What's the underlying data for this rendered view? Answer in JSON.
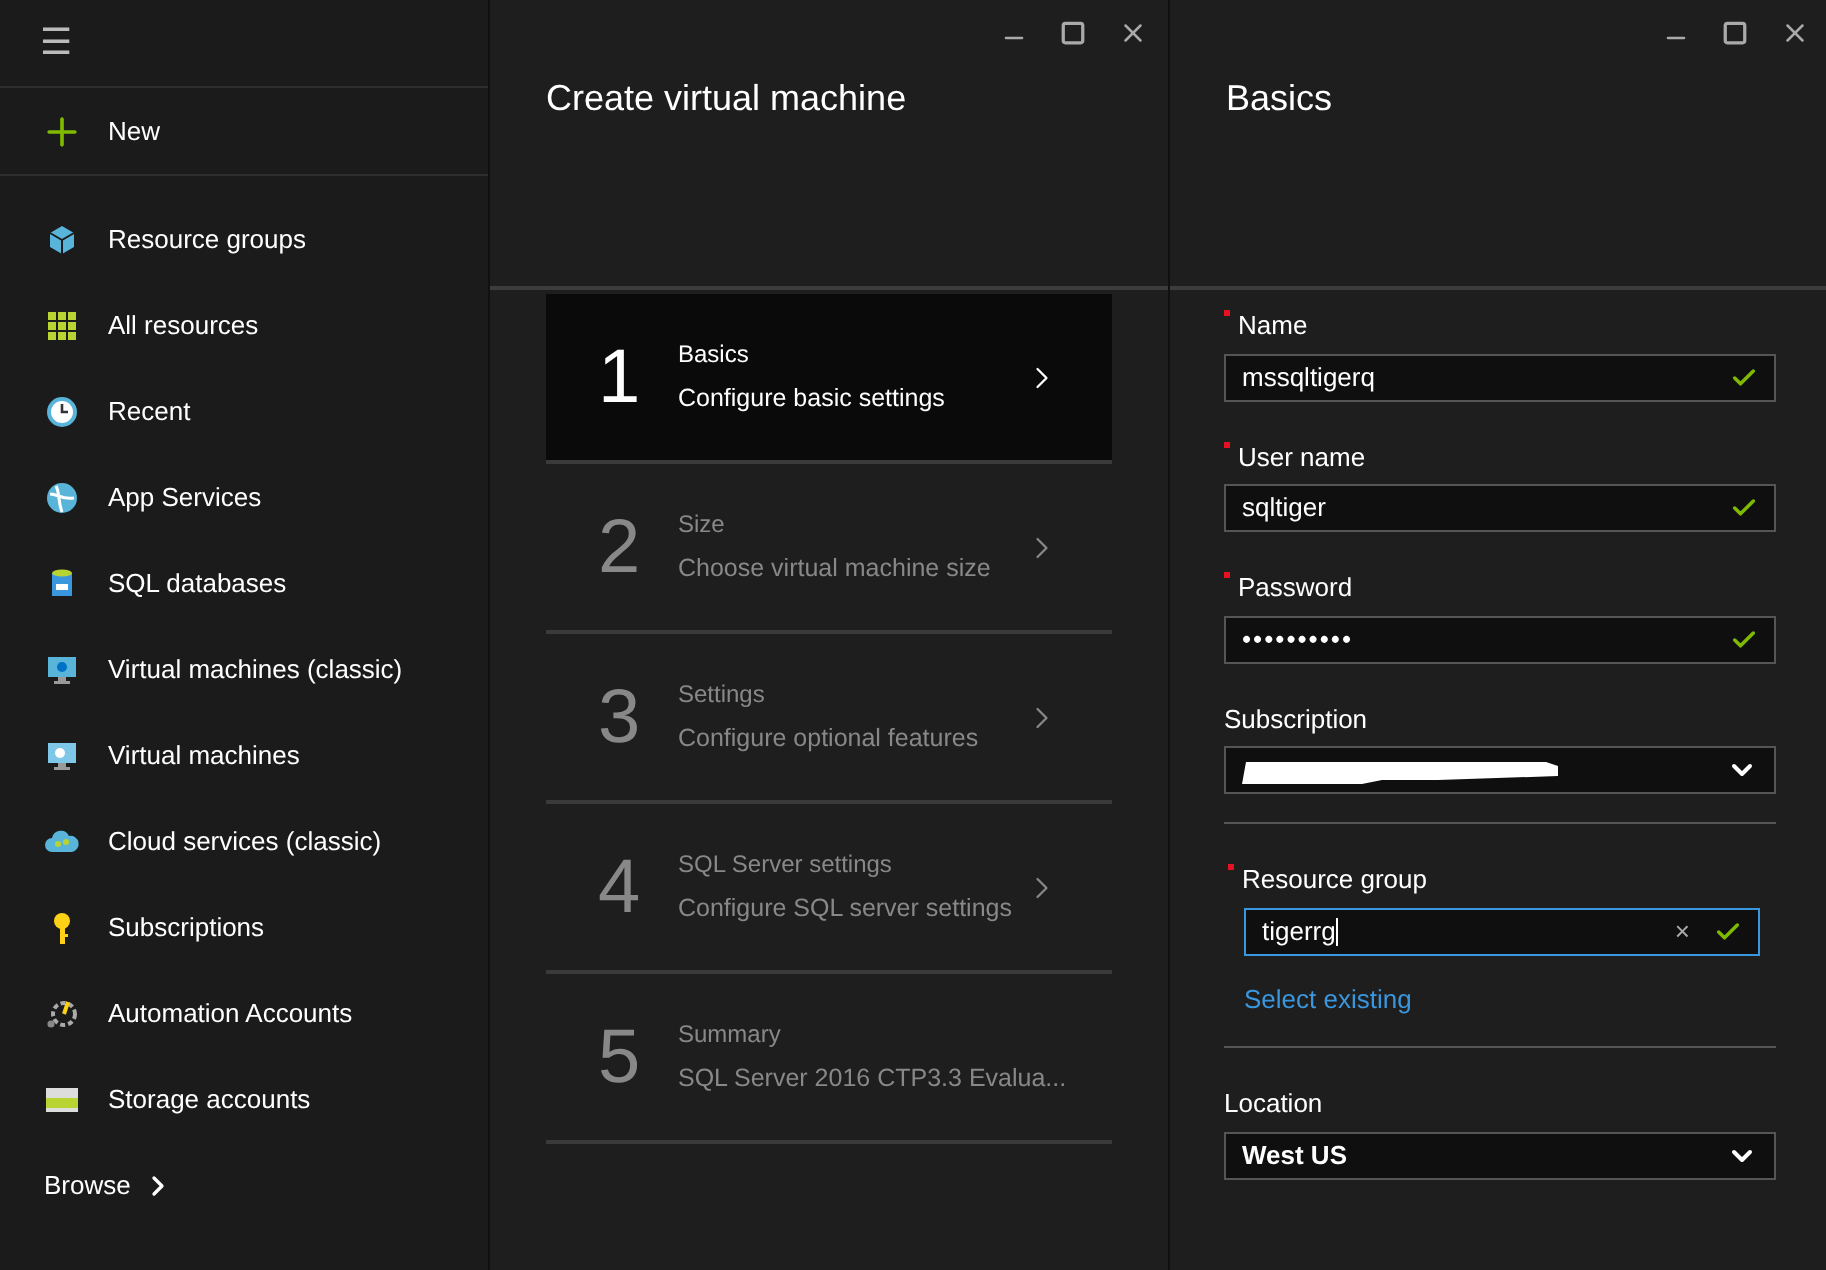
{
  "sidebar": {
    "menu_glyph": "☰",
    "new_label": "New",
    "items": [
      {
        "label": "Resource groups"
      },
      {
        "label": "All resources"
      },
      {
        "label": "Recent"
      },
      {
        "label": "App Services"
      },
      {
        "label": "SQL databases"
      },
      {
        "label": "Virtual machines (classic)"
      },
      {
        "label": "Virtual machines"
      },
      {
        "label": "Cloud services (classic)"
      },
      {
        "label": "Subscriptions"
      },
      {
        "label": "Automation Accounts"
      },
      {
        "label": "Storage accounts"
      }
    ],
    "browse_label": "Browse"
  },
  "wizard": {
    "title": "Create virtual machine",
    "steps": [
      {
        "number": "1",
        "title": "Basics",
        "subtitle": "Configure basic settings",
        "selected": true
      },
      {
        "number": "2",
        "title": "Size",
        "subtitle": "Choose virtual machine size",
        "selected": false
      },
      {
        "number": "3",
        "title": "Settings",
        "subtitle": "Configure optional features",
        "selected": false
      },
      {
        "number": "4",
        "title": "SQL Server settings",
        "subtitle": "Configure SQL server settings",
        "selected": false
      },
      {
        "number": "5",
        "title": "Summary",
        "subtitle": "SQL Server 2016 CTP3.3 Evalua...",
        "selected": false
      }
    ]
  },
  "basics": {
    "title": "Basics",
    "fields": [
      {
        "kind": "text",
        "label": "Name",
        "required": true,
        "value": "mssqltigerq",
        "valid": true,
        "focused": false
      },
      {
        "kind": "text",
        "label": "User name",
        "required": true,
        "value": "sqltiger",
        "valid": true,
        "focused": false
      },
      {
        "kind": "password",
        "label": "Password",
        "required": true,
        "value": "••••••••••",
        "valid": true,
        "focused": false
      },
      {
        "kind": "select",
        "label": "Subscription",
        "required": false,
        "redacted": true,
        "divider_after": true
      },
      {
        "kind": "text",
        "label": "Resource group",
        "required": true,
        "value": "tigerrg",
        "valid": true,
        "focused": true,
        "clear_glyph": "×",
        "link": "Select existing",
        "divider_after": true
      },
      {
        "kind": "select",
        "label": "Location",
        "required": false,
        "value": "West US"
      }
    ]
  }
}
